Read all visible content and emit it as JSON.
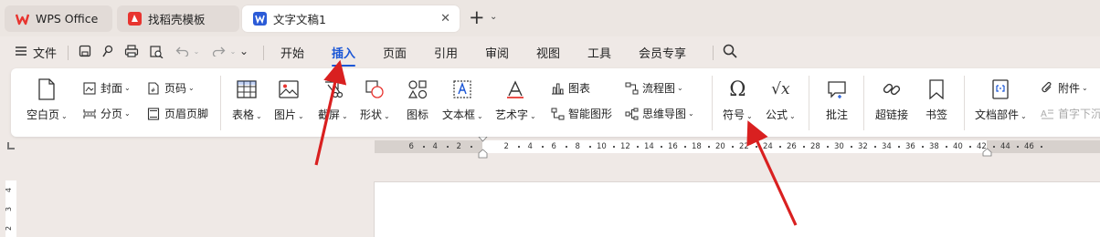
{
  "tabs": [
    {
      "label": "WPS Office"
    },
    {
      "label": "找稻壳模板"
    },
    {
      "label": "文字文稿1"
    }
  ],
  "menu": {
    "file_label": "文件",
    "items": [
      "开始",
      "插入",
      "页面",
      "引用",
      "审阅",
      "视图",
      "工具",
      "会员专享"
    ],
    "active_index": 1
  },
  "ribbon": {
    "blank_page": "空白页",
    "cover": "封面",
    "page_number": "页码",
    "section_break": "分页",
    "header_footer": "页眉页脚",
    "table": "表格",
    "picture": "图片",
    "screenshot": "截屏",
    "shape": "形状",
    "icon": "图标",
    "textbox": "文本框",
    "wordart": "艺术字",
    "chart": "图表",
    "smartart": "智能图形",
    "flowchart": "流程图",
    "mindmap": "思维导图",
    "symbol": "符号",
    "formula": "公式",
    "comment": "批注",
    "hyperlink": "超链接",
    "bookmark": "书签",
    "doc_parts": "文档部件",
    "attachment": "附件",
    "dropcap": "首字下沉"
  },
  "ruler": {
    "h_ticks": [
      "6",
      "4",
      "2",
      "2",
      "4",
      "6",
      "8",
      "10",
      "12",
      "14",
      "16",
      "18",
      "20",
      "22",
      "24",
      "26",
      "28",
      "30",
      "32",
      "34",
      "36",
      "38",
      "40",
      "42",
      "44",
      "46"
    ],
    "v_ticks": [
      "4",
      "3",
      "2"
    ]
  },
  "colors": {
    "accent": "#1a56d6",
    "annotation_arrow": "#d92020",
    "wps_red": "#e8342f",
    "word_blue": "#2b5bd7"
  }
}
